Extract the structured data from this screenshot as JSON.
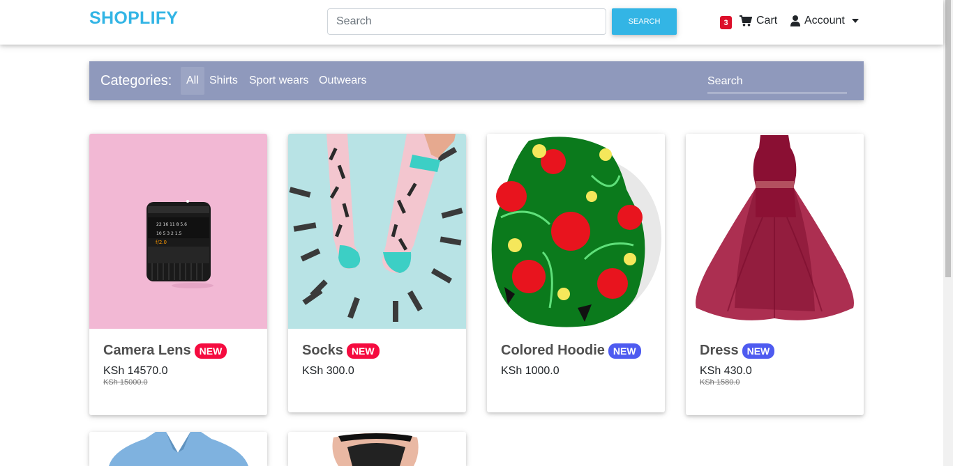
{
  "navbar": {
    "brand": "SHOPLIFY",
    "search_placeholder": "Search",
    "search_button": "SEARCH",
    "cart_count": "3",
    "cart_label": "Cart",
    "account_label": "Account"
  },
  "categories": {
    "title": "Categories:",
    "items": [
      "All",
      "Shirts",
      "Sport wears",
      "Outwears"
    ],
    "active": "All",
    "search_placeholder": "Search"
  },
  "products": [
    {
      "name": "Camera Lens",
      "badge": "NEW",
      "badge_color": "#f50b3f",
      "price": "KSh 14570.0",
      "old_price": "KSh 15000.0",
      "image": "camera-lens-image"
    },
    {
      "name": "Socks",
      "badge": "NEW",
      "badge_color": "#f50b3f",
      "price": "KSh 300.0",
      "old_price": "",
      "image": "socks-image"
    },
    {
      "name": "Colored Hoodie",
      "badge": "NEW",
      "badge_color": "#4e5bf0",
      "price": "KSh 1000.0",
      "old_price": "",
      "image": "hoodie-image"
    },
    {
      "name": "Dress",
      "badge": "NEW",
      "badge_color": "#4e5bf0",
      "price": "KSh 430.0",
      "old_price": "KSh 1580.0",
      "image": "dress-image"
    }
  ],
  "colors": {
    "brand": "#33b5e5",
    "category_bar": "#8f99bc",
    "badge_red": "#f50b3f",
    "badge_blue": "#4e5bf0",
    "cart_badge": "#dc0f2a"
  }
}
